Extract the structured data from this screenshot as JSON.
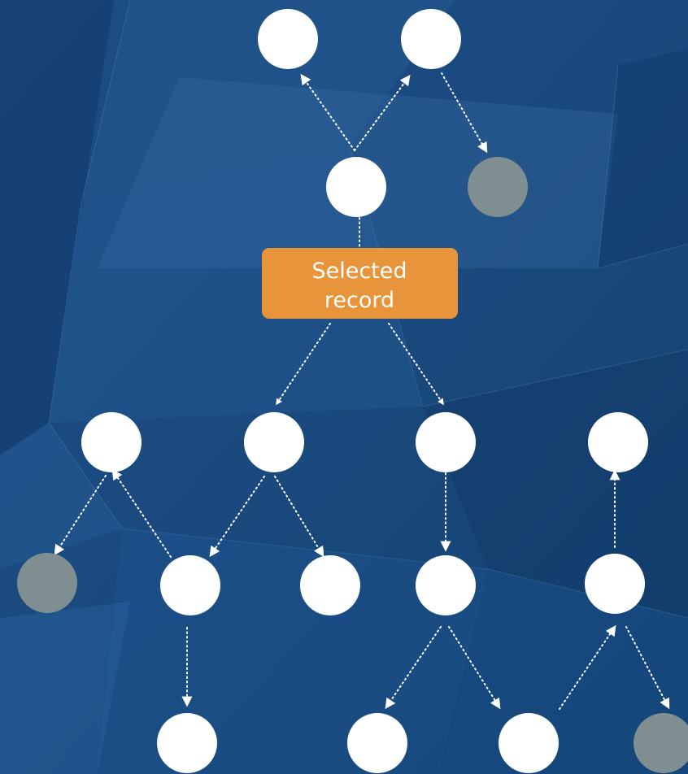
{
  "selected_record": {
    "line1": "Selected",
    "line2": "record"
  },
  "colors": {
    "node_active": "#ffffff",
    "node_inactive": "#7f8f91",
    "selected_box": "#e8943a",
    "edge": "#ffffff",
    "background_dark": "#123a6a",
    "background_light": "#2a649e"
  }
}
